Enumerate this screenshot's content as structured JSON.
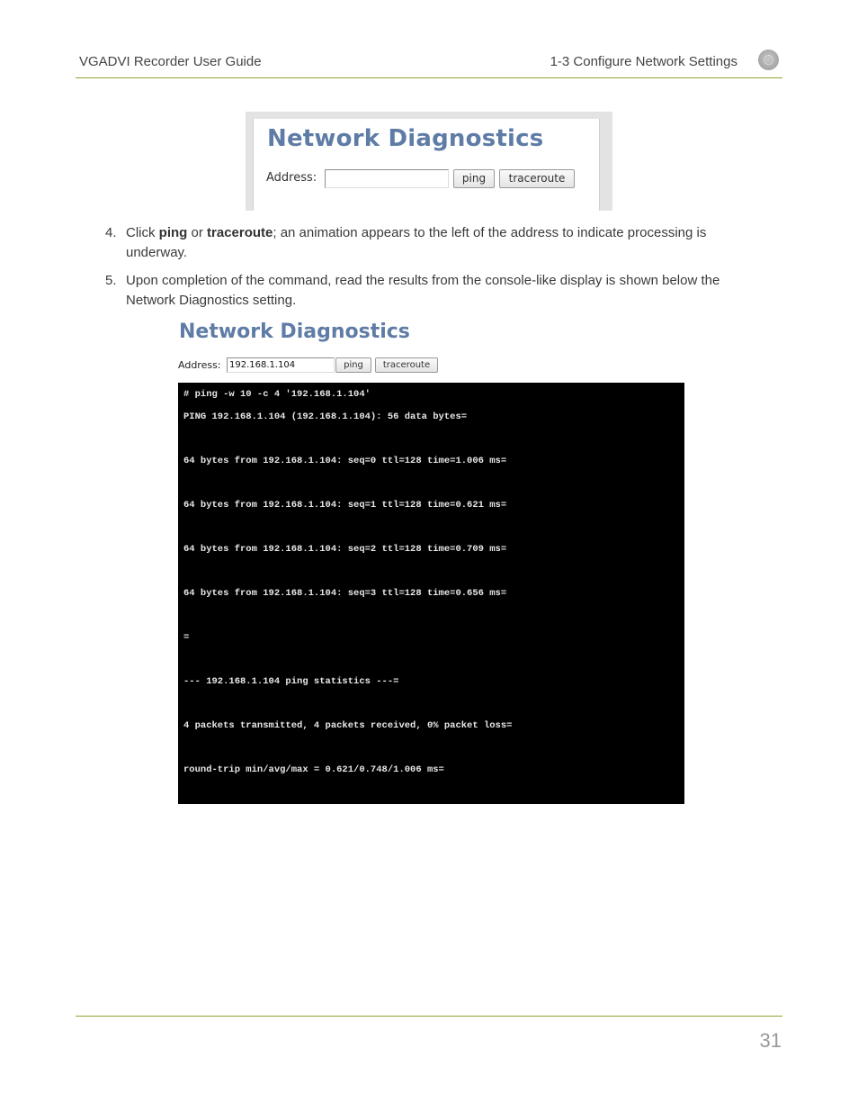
{
  "header": {
    "doc_title": "VGADVI Recorder User Guide",
    "section_title": "1-3 Configure Network Settings",
    "icon": "epiphan-logo-icon"
  },
  "screenshot_empty": {
    "title": "Network Diagnostics",
    "address_label": "Address:",
    "address_value": "",
    "ping_label": "ping",
    "traceroute_label": "traceroute"
  },
  "steps": [
    {
      "number": "4.",
      "pre": "Click ",
      "bold1": "ping",
      "mid": " or ",
      "bold2": "traceroute",
      "post": "; an animation appears to the left of the address to indicate processing is underway."
    },
    {
      "number": "5.",
      "text": "Upon completion of the command, read the results from the console-like display is shown below the Network Diagnostics setting."
    }
  ],
  "screenshot_result": {
    "title": "Network Diagnostics",
    "address_label": "Address:",
    "address_value": "192.168.1.104",
    "ping_label": "ping",
    "traceroute_label": "traceroute",
    "console_lines": [
      "# ping -w 10 -c 4 '192.168.1.104'",
      "PING 192.168.1.104 (192.168.1.104): 56 data bytes=",
      "64 bytes from 192.168.1.104: seq=0 ttl=128 time=1.006 ms=",
      "64 bytes from 192.168.1.104: seq=1 ttl=128 time=0.621 ms=",
      "64 bytes from 192.168.1.104: seq=2 ttl=128 time=0.709 ms=",
      "64 bytes from 192.168.1.104: seq=3 ttl=128 time=0.656 ms=",
      "=",
      "--- 192.168.1.104 ping statistics ---=",
      "4 packets transmitted, 4 packets received, 0% packet loss=",
      "round-trip min/avg/max = 0.621/0.748/1.006 ms="
    ]
  },
  "footer": {
    "page_number": "31"
  },
  "colors": {
    "rule": "#8ca22e",
    "heading_blue": "#5f7ca6",
    "console_bg": "#000000"
  }
}
